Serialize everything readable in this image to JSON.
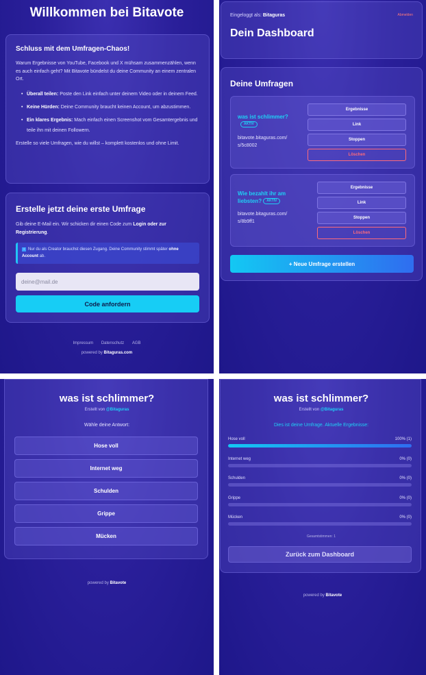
{
  "landing": {
    "title": "Willkommen bei Bitavote",
    "intro": {
      "heading": "Schluss mit dem Umfragen-Chaos!",
      "text": "Warum Ergebnisse von YouTube, Facebook und X mühsam zusammenzählen, wenn es auch einfach geht? Mit Bitavote bündelst du deine Community an einem zentralen Ort.",
      "bullets": [
        {
          "bold": "Überall teilen:",
          "text": " Poste den Link einfach unter deinem Video oder in deinem Feed."
        },
        {
          "bold": "Keine Hürden:",
          "text": " Deine Community braucht keinen Account, um abzustimmen."
        },
        {
          "bold": "Ein klares Ergebnis:",
          "text": " Mach einfach einen Screenshot vom Gesamtergebnis und teile ihn mit deinen Followern."
        }
      ],
      "outro": "Erstelle so viele Umfragen, wie du willst – komplett kostenlos und ohne Limit."
    },
    "signup": {
      "heading": "Erstelle jetzt deine erste Umfrage",
      "desc_pre": "Gib deine E-Mail ein. Wir schicken dir einen Code zum ",
      "desc_login": "Login",
      "desc_mid": " oder zur ",
      "desc_reg": "Registrierung",
      "desc_end": ".",
      "info_icon": "i",
      "info_pre": "Nur du als Creator brauchst diesen Zugang. Deine Community stimmt später ",
      "info_bold": "ohne Account",
      "info_end": " ab.",
      "email_placeholder": "deine@mail.de",
      "button": "Code anfordern"
    },
    "footer": {
      "links": [
        "Impressum",
        "Datenschutz",
        "AGB"
      ],
      "powered_pre": "powered by ",
      "powered_brand": "Bitaguras.com"
    }
  },
  "dashboard": {
    "logged_in_label": "Eingeloggt als: ",
    "username": "Bitaguras",
    "logout": "Abmelden",
    "title": "Dein Dashboard",
    "polls_heading": "Deine Umfragen",
    "polls": [
      {
        "question": "was ist schlimmer?",
        "status": "AKTIV",
        "url_line1": "bitavote.bitaguras.com/",
        "url_line2": "s/5c8002"
      },
      {
        "question_line1": "Wie bezahlt ihr am",
        "question_line2": "liebsten?",
        "status": "AKTIV",
        "url_line1": "bitavote.bitaguras.com/",
        "url_line2": "s/8b9ff1"
      }
    ],
    "actions": {
      "results": "Ergebnisse",
      "link": "Link",
      "stop": "Stoppen",
      "delete": "Löschen"
    },
    "new_poll": "+ Neue Umfrage erstellen"
  },
  "vote": {
    "title": "was ist schlimmer?",
    "by_label": "Erstellt von ",
    "by_user": "@Bitaguras",
    "choose": "Wähle deine Antwort:",
    "options": [
      "Hose voll",
      "Internet weg",
      "Schulden",
      "Grippe",
      "Mücken"
    ],
    "powered_pre": "powered by ",
    "powered_brand": "Bitavote"
  },
  "results": {
    "title": "was ist schlimmer?",
    "by_label": "Erstellt von ",
    "by_user": "@Bitaguras",
    "note": "Dies ist deine Umfrage. Aktuelle Ergebnisse:",
    "rows": [
      {
        "label": "Hose voll",
        "value": "100% (1)",
        "fraction": 1.0
      },
      {
        "label": "Internet weg",
        "value": "0% (0)",
        "fraction": 0
      },
      {
        "label": "Schulden",
        "value": "0% (0)",
        "fraction": 0
      },
      {
        "label": "Grippe",
        "value": "0% (0)",
        "fraction": 0
      },
      {
        "label": "Mücken",
        "value": "0% (0)",
        "fraction": 0
      }
    ],
    "total": "Gesamtstimmen: 1",
    "back": "Zurück zum Dashboard",
    "powered_pre": "powered by ",
    "powered_brand": "Bitavote"
  },
  "colors": {
    "accent": "#17cdf5",
    "danger": "#ff6b7a",
    "background": "#2a1f9a"
  }
}
